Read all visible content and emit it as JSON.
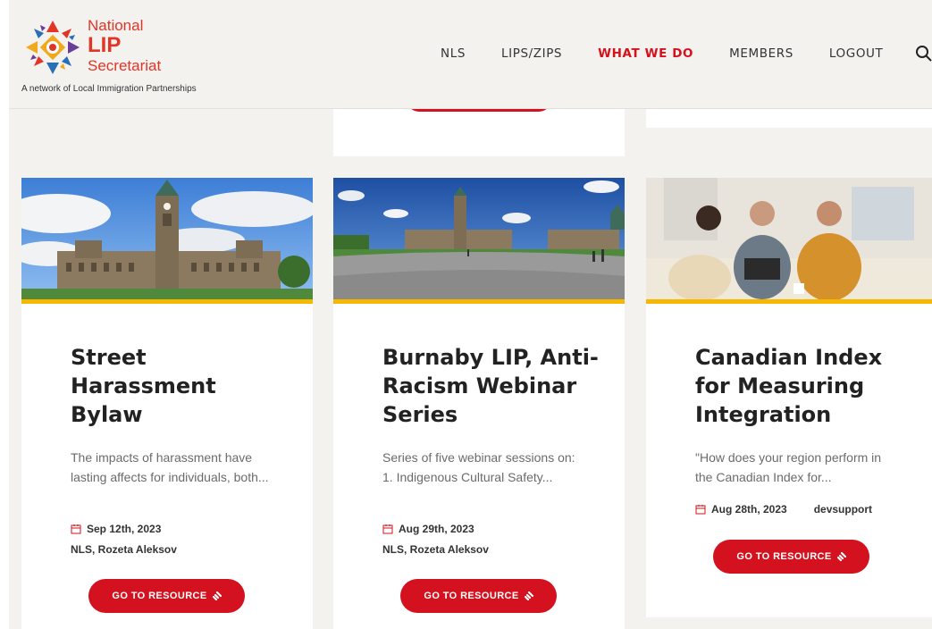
{
  "brand": {
    "line1": "National",
    "line2": "LIP",
    "line3": "Secretariat",
    "tagline": "A network of Local Immigration Partnerships",
    "color": "#e03527"
  },
  "nav": {
    "items": [
      {
        "label": "NLS",
        "active": false
      },
      {
        "label": "LIPS/ZIPS",
        "active": false
      },
      {
        "label": "WHAT WE DO",
        "active": true
      },
      {
        "label": "MEMBERS",
        "active": false
      },
      {
        "label": "LOGOUT",
        "active": false
      }
    ],
    "search_icon": "search-icon",
    "active_color": "#d4111e"
  },
  "cards": [
    {
      "title": "Street Harassment Bylaw",
      "description": "The impacts of harassment have lasting affects for individuals, both...",
      "date": "Sep 12th, 2023",
      "author": "NLS, Rozeta Aleksov",
      "button": "GO TO RESOURCE"
    },
    {
      "title": "Burnaby LIP, Anti-Racism Webinar Series",
      "description": "Series of five webinar sessions on: 1. Indigenous Cultural Safety...",
      "date": "Aug 29th, 2023",
      "author": "NLS, Rozeta Aleksov",
      "button": "GO TO RESOURCE"
    },
    {
      "title": "Canadian Index for Measuring Integration",
      "description": "\"How does your region perform in the Canadian Index for...",
      "date": "Aug 28th, 2023",
      "author": "devsupport",
      "button": "GO TO RESOURCE"
    }
  ],
  "colors": {
    "accent_red": "#d4111e",
    "accent_yellow": "#f5b700",
    "background": "#f3f2ef"
  }
}
